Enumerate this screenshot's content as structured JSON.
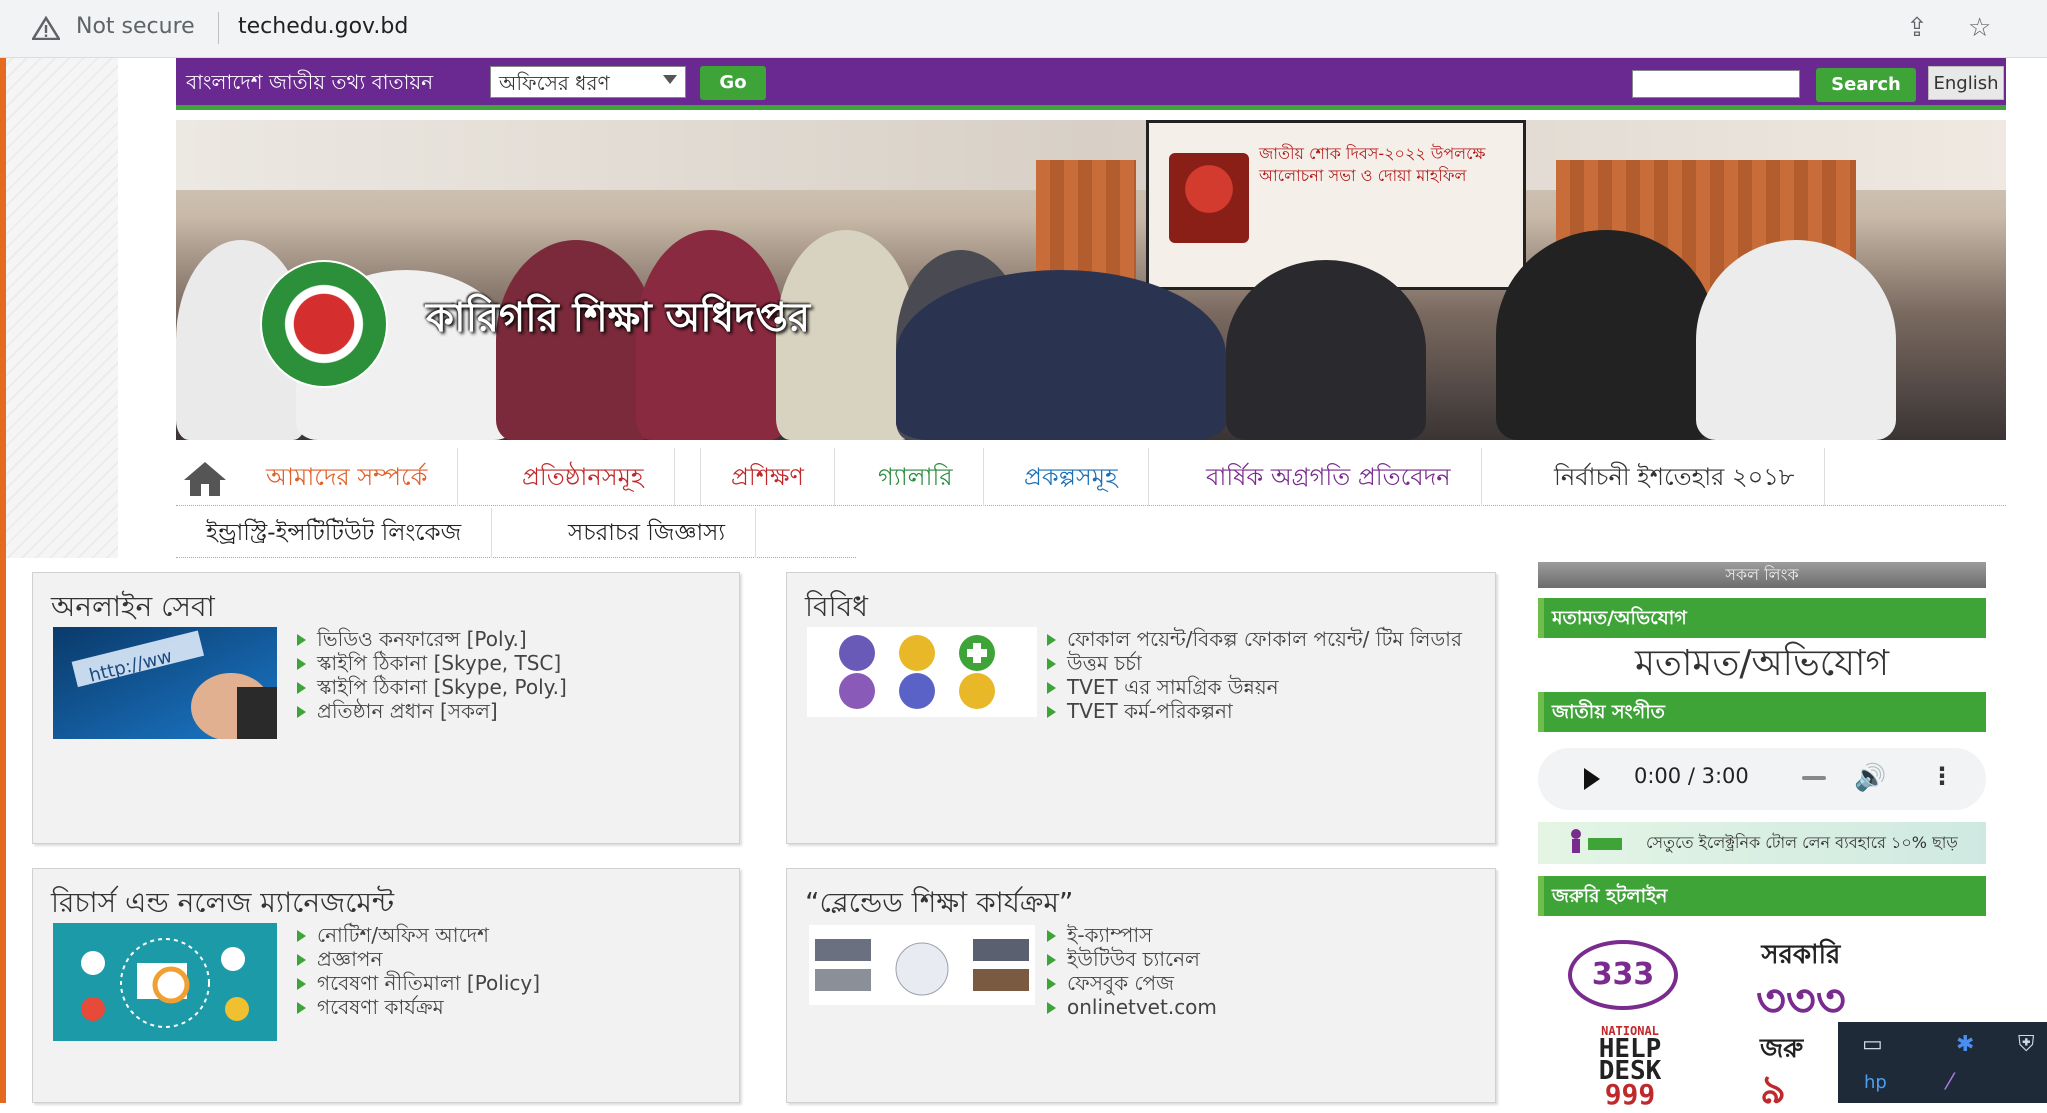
{
  "browser": {
    "security_label": "Not secure",
    "url": "techedu.gov.bd"
  },
  "topbar": {
    "portal_label": "বাংলাদেশ জাতীয় তথ্য বাতায়ন",
    "office_select_value": "অফিসের ধরণ",
    "go_label": "Go",
    "search_label": "Search",
    "english_label": "English"
  },
  "banner": {
    "title": "কারিগরি শিক্ষা অধিদপ্তর",
    "screen_text": "জাতীয় শোক দিবস-২০২২ উপলক্ষে আলোচনা সভা ও দোয়া মাহফিল"
  },
  "nav": {
    "items": [
      {
        "label": "আমাদের সম্পর্কে",
        "color": "#e0602a"
      },
      {
        "label": "প্রতিষ্ঠানসমূহ",
        "color": "#c0282b"
      },
      {
        "label": "প্রশিক্ষণ",
        "color": "#c0282b"
      },
      {
        "label": "গ্যালারি",
        "color": "#2b8a3e"
      },
      {
        "label": "প্রকল্পসমূহ",
        "color": "#1b6fb5"
      },
      {
        "label": "বার্ষিক অগ্রগতি প্রতিবেদন",
        "color": "#7a2b8e"
      },
      {
        "label": "নির্বাচনী ইশতেহার ২০১৮",
        "color": "#333333"
      }
    ],
    "row2": [
      {
        "label": "ইন্ড্রাস্ট্রি-ইন্সটিটিউট লিংকেজ"
      },
      {
        "label": "সচরাচর জিজ্ঞাস্য"
      }
    ]
  },
  "boxes": {
    "online": {
      "title": "অনলাইন সেবা",
      "items": [
        "ভিডিও কনফারেন্স [Poly.]",
        "স্কাইপি ঠিকানা [Skype, TSC]",
        "স্কাইপি ঠিকানা [Skype, Poly.]",
        "প্রতিষ্ঠান প্রধান [সকল]"
      ]
    },
    "misc": {
      "title": "বিবিধ",
      "items": [
        "ফোকাল পয়েন্ট/বিকল্প ফোকাল পয়েন্ট/ টিম লিডার",
        "উত্তম চর্চা",
        "TVET এর সামগ্রিক উন্নয়ন",
        "TVET কর্ম-পরিকল্পনা"
      ]
    },
    "research": {
      "title": "রিচার্স এন্ড নলেজ ম্যানেজমেন্ট",
      "items": [
        "নোটিশ/অফিস আদেশ",
        "প্রজ্ঞাপন",
        "গবেষণা নীতিমালা [Policy]",
        "গবেষণা কার্যক্রম"
      ]
    },
    "blended": {
      "title": "“ব্লেন্ডেড শিক্ষা কার্যক্রম”",
      "items": [
        "ই-ক্যাম্পাস",
        "ইউটিউব চ্যানেল",
        "ফেসবুক পেজ",
        "onlinetvet.com"
      ]
    }
  },
  "sidebar": {
    "all_links": "সকল লিংক",
    "feedback_bar": "মতামত/অভিযোগ",
    "feedback_big": "মতামত/অভিযোগ",
    "anthem_bar": "জাতীয় সংগীত",
    "player_time": "0:00 / 3:00",
    "toll_text": "সেতুতে ইলেক্ট্রনিক টোল লেন ব্যবহারে ১০% ছাড়",
    "hotline_bar": "জরুরি হটলাইন",
    "h333_small": "333",
    "h333_gov": "সরকারি",
    "h333_big": "৩৩৩",
    "h999_a": "NATIONAL",
    "h999_b": "HELP DESK",
    "h999_c": "999",
    "emergency": "জরু",
    "emergency_num": "৯"
  },
  "colors": {
    "topbar": "#6a2891",
    "accent_green": "#3ea437"
  }
}
